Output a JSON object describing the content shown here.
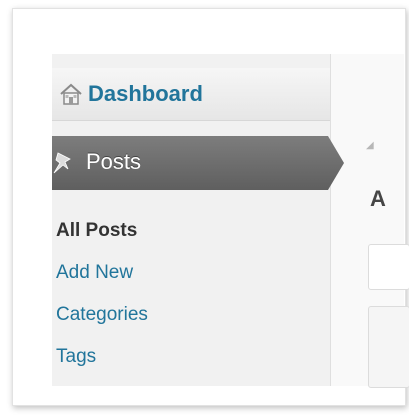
{
  "menu": {
    "dashboard": {
      "label": "Dashboard",
      "icon": "home-icon"
    },
    "posts": {
      "label": "Posts",
      "icon": "pushpin-icon",
      "state": "open"
    },
    "submenu": [
      {
        "label": "All Posts",
        "current": true
      },
      {
        "label": "Add New",
        "current": false
      },
      {
        "label": "Categories",
        "current": false
      },
      {
        "label": "Tags",
        "current": false
      }
    ]
  },
  "content": {
    "heading_fragment": "A"
  },
  "colors": {
    "link": "#21759b",
    "current_text": "#333333",
    "posts_bg": "#6d6d6d",
    "sidebar_bg": "#f1f1f1"
  }
}
